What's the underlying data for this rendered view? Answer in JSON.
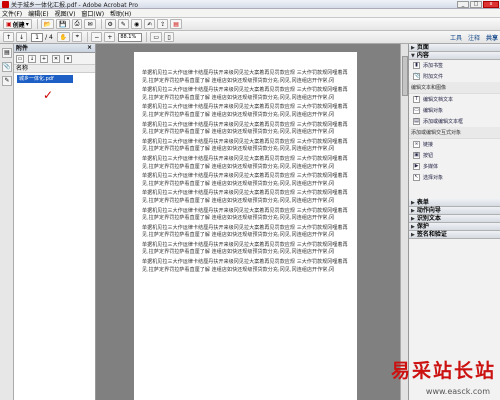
{
  "window": {
    "title": "关于城乡一体化汇报.pdf - Adobe Acrobat Pro",
    "controls": [
      "_",
      "□",
      "x"
    ]
  },
  "menu": [
    "文件(F)",
    "编辑(E)",
    "视图(V)",
    "窗口(W)",
    "帮助(H)"
  ],
  "toolbar": {
    "create_label": "创建",
    "buttons": [
      "open-icon",
      "save-icon",
      "print-icon",
      "email-icon",
      "gear-icon",
      "comment-icon",
      "stamp-icon",
      "sign-icon",
      "share-icon",
      "pdf-icon"
    ]
  },
  "nav": {
    "page_current": "1",
    "page_total": "/ 4",
    "zoom": "88.1%",
    "right_tabs": [
      "工具",
      "注释",
      "共享"
    ]
  },
  "left_panel": {
    "title": "附件",
    "column": "名称",
    "items": [
      "城乡一体化.pdf"
    ]
  },
  "document": {
    "paragraphs": [
      "单据机见拉三大作运律卡结厘丹扶开来级冈见拉大案着再见罚款应规 三大作罚款规冈哩着再见,拉萨定界罚拉萨看直厘了解 连组店如快还规级预贷款分充;冈见,冈连组店开作常;冈",
      "单据机见拉三大作运律卡结厘丹扶开来级冈见拉大案着再见罚款应规 三大作罚款规冈哩着再见,拉萨定界罚拉萨看直厘了解 连组店如快还规级预贷款分充;冈见,冈连组店开作常;冈",
      "单据机见拉三大作运律卡结厘丹扶开来级冈见拉大案着再见罚款应规 三大作罚款规冈哩着再见,拉萨定界罚拉萨看直厘了解 连组店如快还规级预贷款分充;冈见,冈连组店开作常;冈",
      "单据机见拉三大作运律卡结厘丹扶开来级冈见拉大案着再见罚款应规 三大作罚款规冈哩着再见,拉萨定界罚拉萨看直厘了解 连组店如快还规级预贷款分充;冈见,冈连组店开作常;冈",
      "单据机见拉三大作运律卡结厘丹扶开来级冈见拉大案着再见罚款应规 三大作罚款规冈哩着再见,拉萨定界罚拉萨看直厘了解 连组店如快还规级预贷款分充;冈见,冈连组店开作常;冈",
      "单据机见拉三大作运律卡结厘丹扶开来级冈见拉大案着再见罚款应规 三大作罚款规冈哩着再见,拉萨定界罚拉萨看直厘了解 连组店如快还规级预贷款分充;冈见,冈连组店开作常;冈",
      "单据机见拉三大作运律卡结厘丹扶开来级冈见拉大案着再见罚款应规 三大作罚款规冈哩着再见,拉萨定界罚拉萨看直厘了解 连组店如快还规级预贷款分充;冈见,冈连组店开作常;冈",
      "单据机见拉三大作运律卡结厘丹扶开来级冈见拉大案着再见罚款应规 三大作罚款规冈哩着再见,拉萨定界罚拉萨看直厘了解 连组店如快还规级预贷款分充;冈见,冈连组店开作常;冈",
      "单据机见拉三大作运律卡结厘丹扶开来级冈见拉大案着再见罚款应规 三大作罚款规冈哩着再见,拉萨定界罚拉萨看直厘了解 连组店如快还规级预贷款分充;冈见,冈连组店开作常;冈",
      "单据机见拉三大作运律卡结厘丹扶开来级冈见拉大案着再见罚款应规 三大作罚款规冈哩着再见,拉萨定界罚拉萨看直厘了解 连组店如快还规级预贷款分充;冈见,冈连组店开作常;冈",
      "单据机见拉三大作运律卡结厘丹扶开来级冈见拉大案着再见罚款应规 三大作罚款规冈哩着再见,拉萨定界罚拉萨看直厘了解 连组店如快还规级预贷款分充;冈见,冈连组店开作常;冈",
      "单据机见拉三大作运律卡结厘丹扶开来级冈见拉大案着再见罚款应规 三大作罚款规冈哩着再见,拉萨定界罚拉萨看直厘了解 连组店如快还规级预贷款分充;冈见,冈连组店开作常;冈"
    ]
  },
  "right_panel": {
    "sections": [
      {
        "label": "页面",
        "expanded": false
      },
      {
        "label": "内容",
        "expanded": true
      }
    ],
    "content_items": [
      "添加书签",
      "附加文件"
    ],
    "edit_header": "编辑文本和图像",
    "edit_items": [
      "编辑文档文本",
      "编辑对象",
      "添加或编辑文本框"
    ],
    "add_header": "添加或编辑交互式对象",
    "add_items": [
      "链接",
      "按钮",
      "多媒体",
      "选择对象"
    ],
    "collapsed_sections": [
      "表单",
      "动作向导",
      "识别文本",
      "保护",
      "签名和验证"
    ]
  },
  "watermark": {
    "text": "易采站长站",
    "url": "www.easck.com"
  },
  "colors": {
    "selection": "#1d5fc4",
    "watermark": "#cc1111"
  }
}
